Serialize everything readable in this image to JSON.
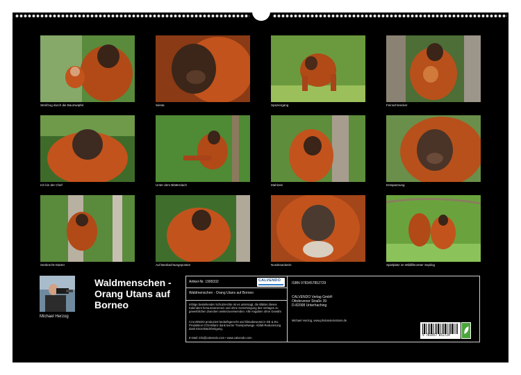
{
  "photos": [
    {
      "caption": "Streifzug durch die Baumwipfel"
    },
    {
      "caption": "Siesta"
    },
    {
      "caption": "Spaziergang"
    },
    {
      "caption": "Feinschmecker"
    },
    {
      "caption": "Ich bin der Chef"
    },
    {
      "caption": "Unter dem Blätterdach"
    },
    {
      "caption": "Mahlzeit"
    },
    {
      "caption": "Entspannung"
    },
    {
      "caption": "Senkrecht-Starter"
    },
    {
      "caption": "Auf Beobachtungsposten"
    },
    {
      "caption": "Nussknackerin"
    },
    {
      "caption": "Spielplatz im Wildlifecenter Sepilog"
    }
  ],
  "author": {
    "name": "Michael Herzog"
  },
  "calendar": {
    "title": "Waldmenschen - Orang Utans auf Borneo",
    "article_nr": "Artikel-Nr. 1999332",
    "logo_text": "CALVENDO",
    "subtitle": "Waldmenschen - Orang Utans auf Borneo",
    "legal_1": "Infolge bestehender Schutzrechte ist es untersagt, die Blätter dieses Kalenders herauszutrennen und ohne Genehmigung des Verlages zu gewerblichen Zwecken weiterzuverwenden. Alle Angaben ohne Gewähr.",
    "legal_2": "CALVENDO produziert bedarfsgerecht und klimabewusst in DE & EU. Produktion CO2-Bilanz dank kurzer Transportwege. Abfall-Reduzierung dank Einzelstückfertigung.",
    "email": "E-Mail: info@calvendo.com • www.calvendo.com",
    "isbn": "ISBN 9783457852729",
    "publisher_name": "CALVENDO Verlag GmbH",
    "publisher_street": "Ottobrunner Straße 39",
    "publisher_city": "D-82008 Unterhaching",
    "author_credit": "Michael Herzog, www.photos4emotions.de",
    "barcode_number": "9 783457 852729"
  },
  "colors": {
    "background": "#000000",
    "orangutan": "#c2531c",
    "foliage": "#3f7a2a"
  }
}
